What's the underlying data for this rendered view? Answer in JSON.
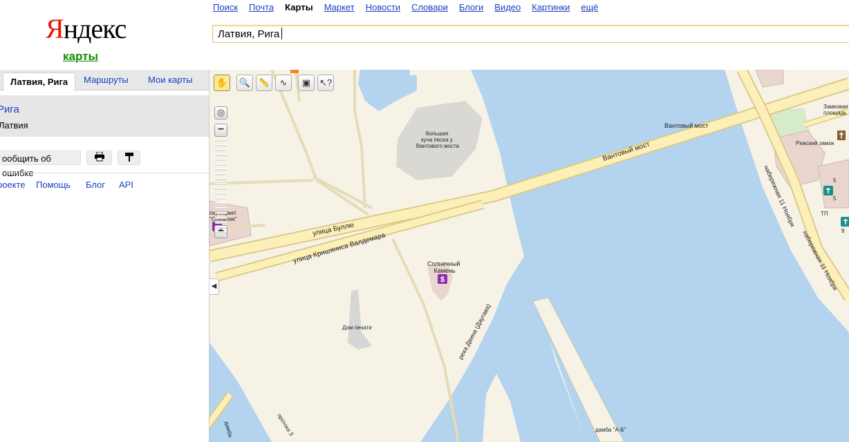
{
  "header": {
    "logo_first": "Я",
    "logo_rest": "ндекс",
    "logo_sub": "карты",
    "nav": [
      "Поиск",
      "Почта",
      "Карты",
      "Маркет",
      "Новости",
      "Словари",
      "Блоги",
      "Видео",
      "Картинки",
      "ещё"
    ],
    "nav_current": "Карты",
    "search_value": "Латвия, Рига"
  },
  "left_panel": {
    "tabs": [
      "Латвия, Рига",
      "Маршруты",
      "Мои карты"
    ],
    "result_title": "Рига",
    "result_subtitle": "Латвия",
    "report_button": "ообщить об ошибке",
    "footer_links": [
      "роекте",
      "Помощь",
      "Блог",
      "API"
    ]
  },
  "map": {
    "labels": {
      "sand": "большая\nкуча песка у\nВантового моста",
      "bridge": "Вантовый мост",
      "bridge2": "Вантовый мост",
      "street1": "улица Буллю",
      "street2": "улица Кришяниса Валдемара",
      "stone": "Солнечный\nКамень",
      "press": "Дом печати",
      "river": "река Двина (Даугава)",
      "emb1": "набережная 11 Ноября",
      "emb2": "набережная 11 Ноября",
      "square": "Замковая\nплощадь",
      "castle": "Рижский замок",
      "market": "пермаркет\n\"Олимпия\"",
      "dam": "дамба \"А-Б\"",
      "channel": "протока З",
      "dam_left": "дамба",
      "tp": "ТП",
      "num5a": "5",
      "num5b": "5",
      "num9": "9"
    },
    "colors": {
      "land": "#f6f3e6",
      "water": "#b3d3ee",
      "road": "#fcf0b8",
      "road_edge": "#dcc98a",
      "park": "#d6ebc9"
    }
  }
}
